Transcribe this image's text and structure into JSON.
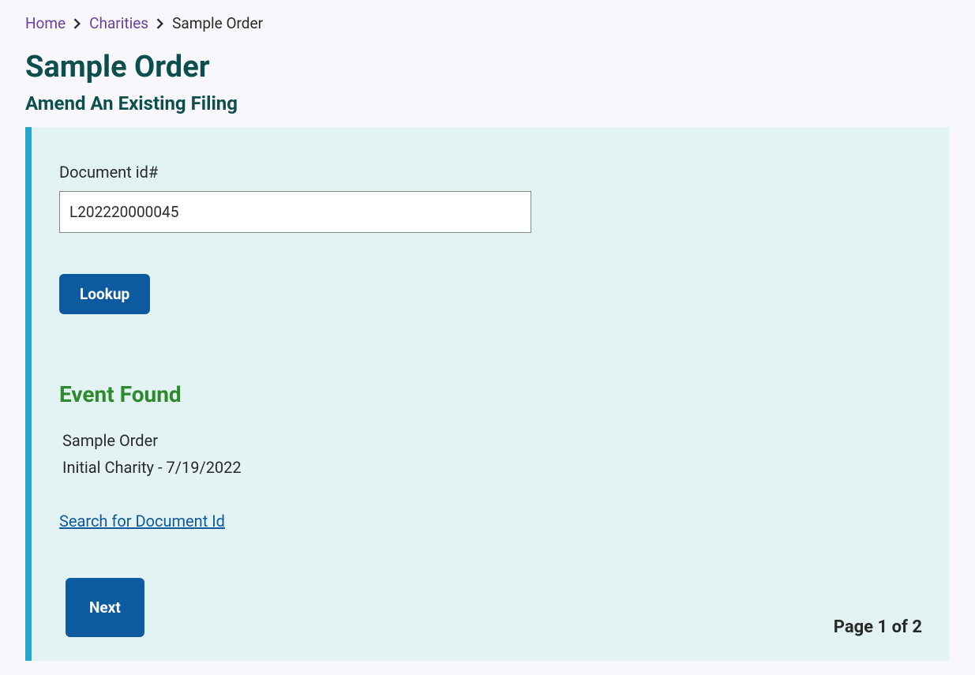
{
  "breadcrumb": {
    "home": "Home",
    "charities": "Charities",
    "current": "Sample Order"
  },
  "page": {
    "title": "Sample Order",
    "subtitle": "Amend An Existing Filing"
  },
  "form": {
    "document_id_label": "Document id#",
    "document_id_value": "L202220000045",
    "lookup_button": "Lookup"
  },
  "result": {
    "heading": "Event Found",
    "line1": "Sample Order",
    "line2": "Initial Charity - 7/19/2022",
    "search_link": "Search for Document Id"
  },
  "footer": {
    "next_button": "Next",
    "page_indicator": "Page 1 of 2"
  }
}
